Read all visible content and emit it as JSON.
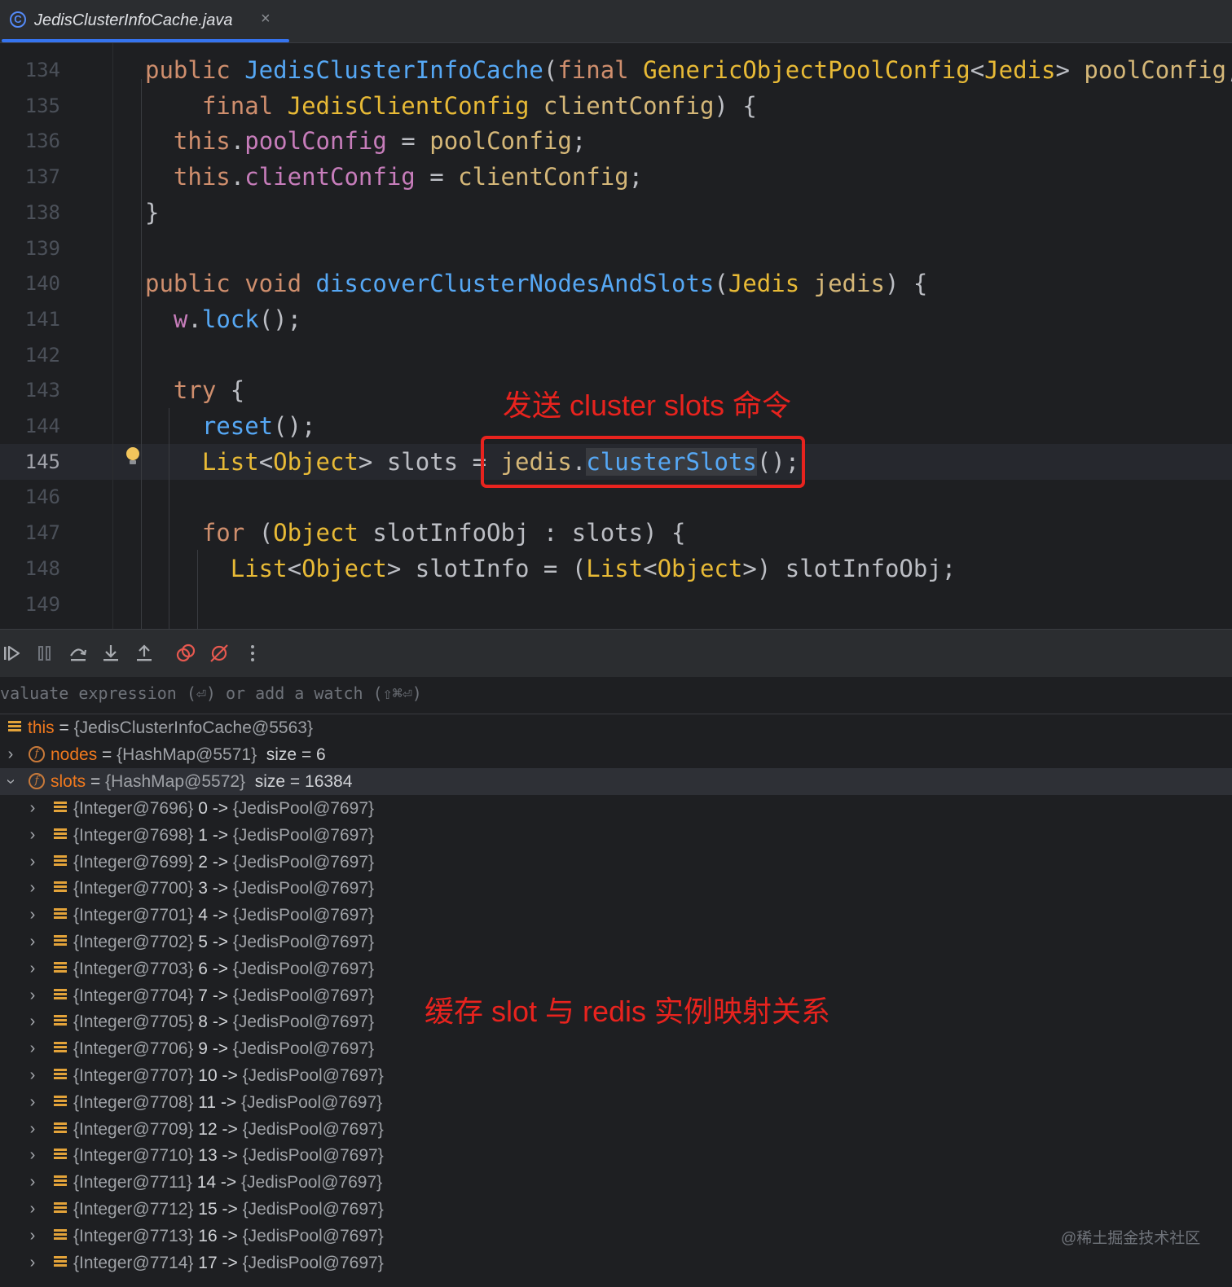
{
  "tab": {
    "label": "JedisClusterInfoCache.java",
    "close": "×",
    "icon_letter": "C"
  },
  "editor": {
    "lines": [
      {
        "num": "134",
        "tokens": [
          {
            "t": "public ",
            "c": "kw"
          },
          {
            "t": "JedisClusterInfoCache",
            "c": "fn"
          },
          {
            "t": "(",
            "c": ""
          },
          {
            "t": "final ",
            "c": "kw"
          },
          {
            "t": "GenericObjectPoolConfig",
            "c": "ty"
          },
          {
            "t": "<",
            "c": ""
          },
          {
            "t": "Jedis",
            "c": "ty"
          },
          {
            "t": "> ",
            "c": ""
          },
          {
            "t": "poolConfig",
            "c": "pm"
          },
          {
            "t": ",",
            "c": ""
          }
        ]
      },
      {
        "num": "135",
        "tokens": [
          {
            "t": "    final ",
            "c": "kw"
          },
          {
            "t": "JedisClientConfig ",
            "c": "ty"
          },
          {
            "t": "clientConfig",
            "c": "pm"
          },
          {
            "t": ") {",
            "c": ""
          }
        ]
      },
      {
        "num": "136",
        "tokens": [
          {
            "t": "  this",
            "c": "kw"
          },
          {
            "t": ".",
            "c": ""
          },
          {
            "t": "poolConfig",
            "c": "fld"
          },
          {
            "t": " = ",
            "c": ""
          },
          {
            "t": "poolConfig",
            "c": "pm"
          },
          {
            "t": ";",
            "c": ""
          }
        ]
      },
      {
        "num": "137",
        "tokens": [
          {
            "t": "  this",
            "c": "kw"
          },
          {
            "t": ".",
            "c": ""
          },
          {
            "t": "clientConfig",
            "c": "fld"
          },
          {
            "t": " = ",
            "c": ""
          },
          {
            "t": "clientConfig",
            "c": "pm"
          },
          {
            "t": ";",
            "c": ""
          }
        ]
      },
      {
        "num": "138",
        "tokens": [
          {
            "t": "}",
            "c": ""
          }
        ]
      },
      {
        "num": "139",
        "tokens": []
      },
      {
        "num": "140",
        "tokens": [
          {
            "t": "public void ",
            "c": "kw"
          },
          {
            "t": "discoverClusterNodesAndSlots",
            "c": "fn"
          },
          {
            "t": "(",
            "c": ""
          },
          {
            "t": "Jedis ",
            "c": "ty"
          },
          {
            "t": "jedis",
            "c": "pm"
          },
          {
            "t": ") {",
            "c": ""
          }
        ]
      },
      {
        "num": "141",
        "tokens": [
          {
            "t": "  w",
            "c": "fld"
          },
          {
            "t": ".",
            "c": ""
          },
          {
            "t": "lock",
            "c": "fn"
          },
          {
            "t": "();",
            "c": ""
          }
        ]
      },
      {
        "num": "142",
        "tokens": []
      },
      {
        "num": "143",
        "tokens": [
          {
            "t": "  try ",
            "c": "kw"
          },
          {
            "t": "{",
            "c": ""
          }
        ]
      },
      {
        "num": "144",
        "tokens": [
          {
            "t": "    reset",
            "c": "fn"
          },
          {
            "t": "();",
            "c": ""
          }
        ]
      },
      {
        "num": "145",
        "tokens": [
          {
            "t": "    List",
            "c": "ty"
          },
          {
            "t": "<",
            "c": ""
          },
          {
            "t": "Object",
            "c": "ty"
          },
          {
            "t": "> slots = ",
            "c": ""
          },
          {
            "t": "jedis",
            "c": "pm"
          },
          {
            "t": ".",
            "c": ""
          },
          {
            "t": "clusterSlots",
            "c": "fn cur"
          },
          {
            "t": "();",
            "c": ""
          }
        ]
      },
      {
        "num": "146",
        "tokens": []
      },
      {
        "num": "147",
        "tokens": [
          {
            "t": "    for ",
            "c": "kw"
          },
          {
            "t": "(",
            "c": ""
          },
          {
            "t": "Object ",
            "c": "ty"
          },
          {
            "t": "slotInfoObj : slots) {",
            "c": ""
          }
        ]
      },
      {
        "num": "148",
        "tokens": [
          {
            "t": "      List",
            "c": "ty"
          },
          {
            "t": "<",
            "c": ""
          },
          {
            "t": "Object",
            "c": "ty"
          },
          {
            "t": "> slotInfo = (",
            "c": ""
          },
          {
            "t": "List",
            "c": "ty"
          },
          {
            "t": "<",
            "c": ""
          },
          {
            "t": "Object",
            "c": "ty"
          },
          {
            "t": ">) slotInfoObj;",
            "c": ""
          }
        ]
      },
      {
        "num": "149",
        "tokens": []
      }
    ],
    "current_line": "145"
  },
  "annotations": {
    "send_command": "发送 cluster slots 命令",
    "cache_mapping": "缓存 slot 与 redis 实例映射关系"
  },
  "debug_toolbar": {
    "icons": [
      "resume-icon",
      "pause-icon",
      "step-over-icon",
      "step-into-icon",
      "step-out-icon",
      "view-breakpoints-icon",
      "mute-breakpoints-icon",
      "more-icon"
    ]
  },
  "watch": {
    "placeholder": "Evaluate expression (⏎) or add a watch (⇧⌘⏎)"
  },
  "variables": {
    "this": {
      "name": "this",
      "eq": " = ",
      "value": "{JedisClusterInfoCache@5563}"
    },
    "nodes": {
      "name": "nodes",
      "eq": " = ",
      "value": "{HashMap@5571}",
      "extra": "  size = 6"
    },
    "slots": {
      "name": "slots",
      "eq": " = ",
      "value": "{HashMap@5572}",
      "extra": "  size = 16384"
    },
    "entries": [
      {
        "key": "{Integer@7696}",
        "idx": "0",
        "val": "{JedisPool@7697}"
      },
      {
        "key": "{Integer@7698}",
        "idx": "1",
        "val": "{JedisPool@7697}"
      },
      {
        "key": "{Integer@7699}",
        "idx": "2",
        "val": "{JedisPool@7697}"
      },
      {
        "key": "{Integer@7700}",
        "idx": "3",
        "val": "{JedisPool@7697}"
      },
      {
        "key": "{Integer@7701}",
        "idx": "4",
        "val": "{JedisPool@7697}"
      },
      {
        "key": "{Integer@7702}",
        "idx": "5",
        "val": "{JedisPool@7697}"
      },
      {
        "key": "{Integer@7703}",
        "idx": "6",
        "val": "{JedisPool@7697}"
      },
      {
        "key": "{Integer@7704}",
        "idx": "7",
        "val": "{JedisPool@7697}"
      },
      {
        "key": "{Integer@7705}",
        "idx": "8",
        "val": "{JedisPool@7697}"
      },
      {
        "key": "{Integer@7706}",
        "idx": "9",
        "val": "{JedisPool@7697}"
      },
      {
        "key": "{Integer@7707}",
        "idx": "10",
        "val": "{JedisPool@7697}"
      },
      {
        "key": "{Integer@7708}",
        "idx": "11",
        "val": "{JedisPool@7697}"
      },
      {
        "key": "{Integer@7709}",
        "idx": "12",
        "val": "{JedisPool@7697}"
      },
      {
        "key": "{Integer@7710}",
        "idx": "13",
        "val": "{JedisPool@7697}"
      },
      {
        "key": "{Integer@7711}",
        "idx": "14",
        "val": "{JedisPool@7697}"
      },
      {
        "key": "{Integer@7712}",
        "idx": "15",
        "val": "{JedisPool@7697}"
      },
      {
        "key": "{Integer@7713}",
        "idx": "16",
        "val": "{JedisPool@7697}"
      },
      {
        "key": "{Integer@7714}",
        "idx": "17",
        "val": "{JedisPool@7697}"
      }
    ],
    "arrow": " -> "
  },
  "watermark": "@稀土掘金技术社区",
  "colors": {
    "accent": "#3574f0",
    "annotation": "#e8231e",
    "field_name": "#f0791e"
  }
}
